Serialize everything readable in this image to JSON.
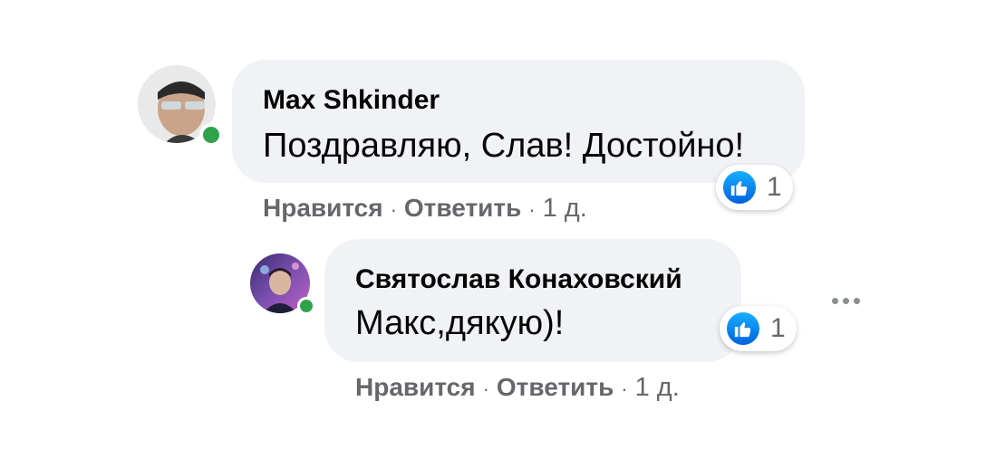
{
  "comments": [
    {
      "author": "Max Shkinder",
      "text": "Поздравляю, Слав! Достойно!",
      "reaction_count": "1",
      "like_label": "Нравится",
      "reply_label": "Ответить",
      "separator": "·",
      "time": "1 д."
    },
    {
      "author": "Святослав Конаховский",
      "text": "Макс,дякую)!",
      "reaction_count": "1",
      "like_label": "Нравится",
      "reply_label": "Ответить",
      "separator": "·",
      "time": "1 д."
    }
  ],
  "icons": {
    "reaction": "like-icon",
    "online": "online-dot-icon",
    "more": "more-options-icon"
  },
  "colors": {
    "bubble": "#f0f2f5",
    "online": "#31a24c",
    "like": "#0f7df2",
    "meta": "#65676b"
  }
}
